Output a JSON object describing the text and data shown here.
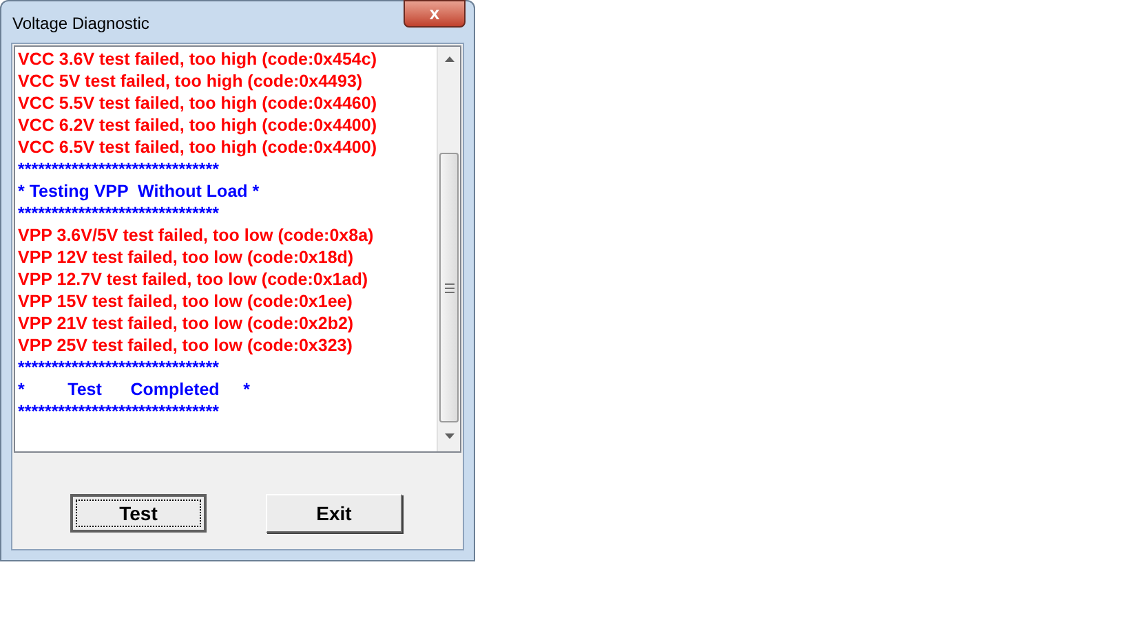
{
  "window": {
    "title": "Voltage Diagnostic",
    "close_label": "x"
  },
  "log": [
    {
      "kind": "error",
      "text": "VCC 3.6V test failed, too high (code:0x454c)"
    },
    {
      "kind": "error",
      "text": "VCC 5V test failed, too high (code:0x4493)"
    },
    {
      "kind": "error",
      "text": "VCC 5.5V test failed, too high (code:0x4460)"
    },
    {
      "kind": "error",
      "text": "VCC 6.2V test failed, too high (code:0x4400)"
    },
    {
      "kind": "error",
      "text": "VCC 6.5V test failed, too high (code:0x4400)"
    },
    {
      "kind": "info",
      "text": "******************************"
    },
    {
      "kind": "info",
      "text": "* Testing VPP  Without Load *"
    },
    {
      "kind": "info",
      "text": "******************************"
    },
    {
      "kind": "error",
      "text": "VPP 3.6V/5V test failed, too low (code:0x8a)"
    },
    {
      "kind": "error",
      "text": "VPP 12V test failed, too low (code:0x18d)"
    },
    {
      "kind": "error",
      "text": "VPP 12.7V test failed, too low (code:0x1ad)"
    },
    {
      "kind": "error",
      "text": "VPP 15V test failed, too low (code:0x1ee)"
    },
    {
      "kind": "error",
      "text": "VPP 21V test failed, too low (code:0x2b2)"
    },
    {
      "kind": "error",
      "text": "VPP 25V test failed, too low (code:0x323)"
    },
    {
      "kind": "info",
      "text": "******************************"
    },
    {
      "kind": "info",
      "text": "*         Test      Completed     *"
    },
    {
      "kind": "info",
      "text": "******************************"
    }
  ],
  "buttons": [
    {
      "label": "Test",
      "focused": true
    },
    {
      "label": "Exit",
      "focused": false
    }
  ]
}
